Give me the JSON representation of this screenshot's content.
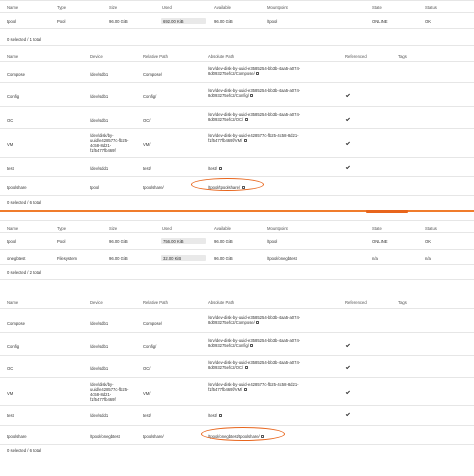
{
  "colors": {
    "accent": "#e8651c",
    "divider": "#f07c2c"
  },
  "pool_headers": [
    "Name",
    "Type",
    "Size",
    "Used",
    "Available",
    "Mountpoint",
    "State",
    "Status"
  ],
  "sections": [
    {
      "pools": [
        {
          "name": "tpool",
          "type": "Pool",
          "size": "96.00 GiB",
          "used": "692.00 KiB",
          "used_fraction": 0.01,
          "available": "96.00 GiB",
          "mountpoint": "/tpool",
          "state": "ONLINE",
          "status": "OK"
        }
      ],
      "pool_footer": "0 selected / 1 total",
      "share_headers": [
        "Name",
        "Device",
        "Relative Path",
        "Absolute Path",
        "Referenced",
        "Tags"
      ],
      "shares": [
        {
          "name": "Compose",
          "device": "/dev/sdb1",
          "relpath": "Compose/",
          "abspath": "/srv/dev-disk-by-uuid-e3585254-bb3b-4aa5-a074-8d093275efc2/Compose/",
          "referenced": false
        },
        {
          "name": "Config",
          "device": "/dev/sdb1",
          "relpath": "Config/",
          "abspath": "/srv/dev-disk-by-uuid-e3585254-bb3b-4aa5-a074-8d093275efc2/Config/",
          "referenced": true
        },
        {
          "name": "OC",
          "device": "/dev/sdb1",
          "relpath": "OC/",
          "abspath": "/srv/dev-disk-by-uuid-e3585254-bb3b-4aa5-a074-8d093275efc2/OC/",
          "referenced": true
        },
        {
          "name": "VM",
          "device": "/dev/disk/by-uuid/e428577c-fb25-4c58-8d21-f1f5477fb469f",
          "relpath": "VM/",
          "abspath": "/srv/dev-disk-by-uuid-e428577c-fb25-4c58-8d21-f1f5477fb469f/VM/",
          "referenced": true
        },
        {
          "name": "test",
          "device": "/dev/sdd1",
          "relpath": "test/",
          "abspath": "/test/",
          "referenced": true
        },
        {
          "name": "tpoolshare",
          "device": "tpool",
          "relpath": "tpoolshare/",
          "abspath": "/tpool/tpoolshare/",
          "referenced": false
        }
      ],
      "share_footer": "0 selected / 6 total"
    },
    {
      "pools": [
        {
          "name": "tpool",
          "type": "Pool",
          "size": "96.00 GiB",
          "used": "756.00 KiB",
          "used_fraction": 0.01,
          "available": "96.00 GiB",
          "mountpoint": "/tpool",
          "state": "ONLINE",
          "status": "OK"
        },
        {
          "name": "onegbtest",
          "type": "Filesystem",
          "size": "96.00 GiB",
          "used": "32.00 KiB",
          "used_fraction": 0.01,
          "available": "96.00 GiB",
          "mountpoint": "/tpool/onegbtest",
          "state": "n/a",
          "status": "n/a"
        }
      ],
      "pool_footer": "0 selected / 2 total",
      "share_headers": [
        "Name",
        "Device",
        "Relative Path",
        "Absolute Path",
        "Referenced",
        "Tags"
      ],
      "shares": [
        {
          "name": "Compose",
          "device": "/dev/sdb1",
          "relpath": "Compose/",
          "abspath": "/srv/dev-disk-by-uuid-e3585254-bb3b-4aa5-a074-8d093275efc2/Compose/",
          "referenced": false
        },
        {
          "name": "Config",
          "device": "/dev/sdb1",
          "relpath": "Config/",
          "abspath": "/srv/dev-disk-by-uuid-e3585254-bb3b-4aa5-a074-8d093275efc2/Config/",
          "referenced": true
        },
        {
          "name": "OC",
          "device": "/dev/sdb1",
          "relpath": "OC/",
          "abspath": "/srv/dev-disk-by-uuid-e3585254-bb3b-4aa5-a074-8d093275efc2/OC/",
          "referenced": true
        },
        {
          "name": "VM",
          "device": "/dev/disk/by-uuid/e428577c-fb25-4c58-8d21-f1f5477fb469f",
          "relpath": "VM/",
          "abspath": "/srv/dev-disk-by-uuid-e428577c-fb25-4c58-8d21-f1f5477fb469f/VM/",
          "referenced": true
        },
        {
          "name": "test",
          "device": "/dev/sdd1",
          "relpath": "test/",
          "abspath": "/test/",
          "referenced": true
        },
        {
          "name": "tpoolshare",
          "device": "/tpool/onegbtest",
          "relpath": "tpoolshare/",
          "abspath": "/tpool/onegbtest/tpoolshare/",
          "referenced": false
        }
      ],
      "share_footer": "0 selected / 6 total"
    }
  ]
}
